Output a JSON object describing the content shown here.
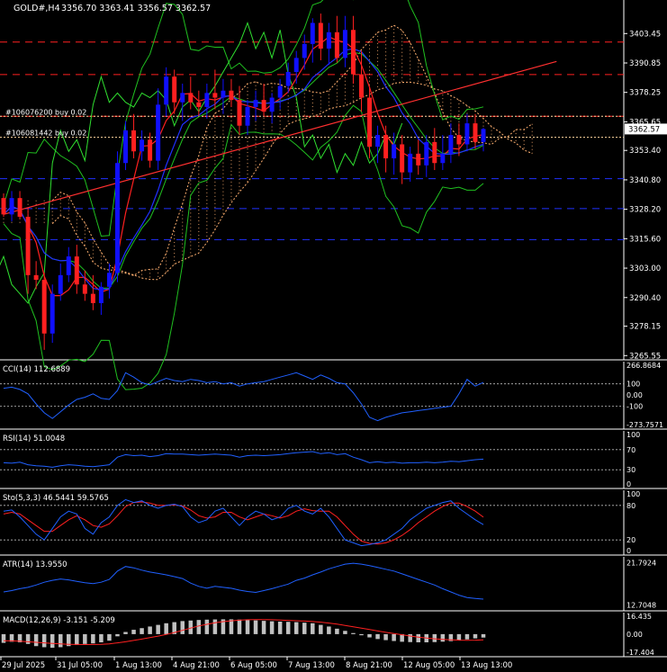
{
  "header": {
    "symbol_label": "GOLD#,H4",
    "ohlc_label": "3356.70 3363.41 3356.57 3362.57"
  },
  "colors": {
    "background": "#000000",
    "grid_text": "#ffffff",
    "bull_candle": "#1010ff",
    "bear_candle": "#ff2020",
    "bollinger": "#20c020",
    "bright_green": "#30e030",
    "ma_red": "#ff2020",
    "ma_blue": "#2030ff",
    "cloud_dots": "#ffb070",
    "order_line": "#ffd8a0",
    "red_dash": "#ff2020",
    "blue_dash": "#2030ff",
    "trendline": "#ff3030",
    "oscillator_line": "#2060ff",
    "stoch_signal": "#ff2020",
    "macd_hist": "#c0c0c0",
    "macd_signal": "#ff2020"
  },
  "chart_data": [
    {
      "type": "candlestick",
      "panel": "main",
      "price_axis_ticks": [
        "3403.45",
        "3390.85",
        "3378.25",
        "3365.65",
        "3353.40",
        "3340.80",
        "3328.20",
        "3315.60",
        "3303.00",
        "3290.40",
        "3278.15",
        "3265.55"
      ],
      "price_axis_values": [
        3403.45,
        3390.85,
        3378.25,
        3365.65,
        3353.4,
        3340.8,
        3328.2,
        3315.6,
        3303.0,
        3290.4,
        3278.15,
        3265.55
      ],
      "ylim": [
        3264.5,
        3415.5
      ],
      "current_price_label": "3362.57",
      "current_price": 3362.57,
      "orders": [
        {
          "label": "#106076200 buy 0.02",
          "price": 3368.0
        },
        {
          "label": "#106081442 buy 0.02",
          "price": 3359.0
        }
      ],
      "red_levels": [
        3399.8,
        3385.9,
        3368.0
      ],
      "blue_levels": [
        3341.3,
        3328.5,
        3315.2
      ],
      "trendline": {
        "from": [
          0,
          3326.0
        ],
        "to": [
          68,
          3391.5
        ]
      },
      "candles": [
        [
          3333,
          3335,
          3325,
          3326
        ],
        [
          3326,
          3336,
          3323,
          3333
        ],
        [
          3333,
          3336,
          3324,
          3325
        ],
        [
          3325,
          3329,
          3292,
          3300
        ],
        [
          3300,
          3306,
          3294,
          3298
        ],
        [
          3298,
          3301,
          3268,
          3275
        ],
        [
          3275,
          3296,
          3271,
          3292
        ],
        [
          3292,
          3305,
          3289,
          3300
        ],
        [
          3300,
          3312,
          3297,
          3308
        ],
        [
          3308,
          3313,
          3292,
          3296
        ],
        [
          3296,
          3302,
          3289,
          3292
        ],
        [
          3292,
          3300,
          3285,
          3288
        ],
        [
          3288,
          3297,
          3283,
          3295
        ],
        [
          3295,
          3305,
          3290,
          3301
        ],
        [
          3301,
          3353,
          3297,
          3348
        ],
        [
          3348,
          3366,
          3345,
          3362
        ],
        [
          3362,
          3369,
          3350,
          3353
        ],
        [
          3353,
          3362,
          3349,
          3358
        ],
        [
          3358,
          3361,
          3346,
          3349
        ],
        [
          3349,
          3380,
          3345,
          3373
        ],
        [
          3373,
          3389,
          3368,
          3385
        ],
        [
          3385,
          3388,
          3369,
          3374
        ],
        [
          3374,
          3382,
          3366,
          3378
        ],
        [
          3378,
          3385,
          3371,
          3374
        ],
        [
          3374,
          3379,
          3368,
          3372
        ],
        [
          3372,
          3382,
          3367,
          3378
        ],
        [
          3378,
          3388,
          3371,
          3376
        ],
        [
          3376,
          3384,
          3369,
          3379
        ],
        [
          3379,
          3384,
          3372,
          3375
        ],
        [
          3375,
          3381,
          3360,
          3364
        ],
        [
          3364,
          3375,
          3360,
          3372
        ],
        [
          3372,
          3379,
          3366,
          3375
        ],
        [
          3375,
          3382,
          3368,
          3370
        ],
        [
          3370,
          3378,
          3365,
          3376
        ],
        [
          3376,
          3384,
          3371,
          3381
        ],
        [
          3381,
          3391,
          3378,
          3387
        ],
        [
          3387,
          3396,
          3382,
          3393
        ],
        [
          3393,
          3403,
          3388,
          3399
        ],
        [
          3399,
          3410,
          3391,
          3408
        ],
        [
          3408,
          3412,
          3392,
          3397
        ],
        [
          3397,
          3408,
          3390,
          3404
        ],
        [
          3404,
          3411,
          3391,
          3393
        ],
        [
          3393,
          3411,
          3389,
          3405
        ],
        [
          3405,
          3411,
          3382,
          3386
        ],
        [
          3386,
          3396,
          3370,
          3376
        ],
        [
          3376,
          3381,
          3350,
          3355
        ],
        [
          3355,
          3364,
          3348,
          3360
        ],
        [
          3360,
          3364,
          3344,
          3350
        ],
        [
          3350,
          3361,
          3343,
          3356
        ],
        [
          3356,
          3360,
          3339,
          3344
        ],
        [
          3344,
          3355,
          3340,
          3352
        ],
        [
          3352,
          3358,
          3343,
          3347
        ],
        [
          3347,
          3360,
          3342,
          3357
        ],
        [
          3357,
          3363,
          3345,
          3348
        ],
        [
          3348,
          3360,
          3345,
          3352
        ],
        [
          3352,
          3365,
          3348,
          3360
        ],
        [
          3360,
          3365,
          3351,
          3356
        ],
        [
          3356,
          3369,
          3353,
          3365
        ],
        [
          3365,
          3369,
          3354,
          3357
        ],
        [
          3357,
          3363,
          3353,
          3362.57
        ]
      ]
    },
    {
      "type": "line",
      "panel": "cci",
      "label": "CCI(14) 112.6889",
      "axis_ticks": [
        "266.8684",
        "100",
        "0.00",
        "-100",
        "-273.7571"
      ],
      "axis_values": [
        266.8684,
        100,
        0,
        -100,
        -273.7571
      ],
      "dashed_levels": [
        100,
        -100
      ],
      "ylim": [
        -273.7571,
        266.8684
      ],
      "values": [
        60,
        70,
        50,
        10,
        -80,
        -160,
        -210,
        -150,
        -90,
        -40,
        -20,
        10,
        -30,
        -40,
        40,
        200,
        160,
        110,
        90,
        120,
        150,
        130,
        120,
        140,
        130,
        110,
        120,
        100,
        110,
        80,
        100,
        110,
        120,
        140,
        160,
        180,
        200,
        170,
        140,
        180,
        150,
        110,
        100,
        20,
        -80,
        -200,
        -230,
        -200,
        -180,
        -160,
        -150,
        -140,
        -130,
        -120,
        -110,
        -100,
        10,
        140,
        80,
        112.6889
      ]
    },
    {
      "type": "line",
      "panel": "rsi",
      "label": "RSI(14) 51.0048",
      "axis_ticks": [
        "100",
        "70",
        "30",
        "0"
      ],
      "axis_values": [
        100,
        70,
        30,
        0
      ],
      "dashed_levels": [
        70,
        30
      ],
      "ylim": [
        0,
        100
      ],
      "values": [
        44,
        43,
        45,
        40,
        38,
        37,
        35,
        38,
        40,
        39,
        37,
        36,
        38,
        40,
        55,
        60,
        58,
        59,
        56,
        58,
        62,
        61,
        61,
        60,
        59,
        60,
        61,
        60,
        59,
        55,
        58,
        59,
        58,
        59,
        60,
        62,
        64,
        65,
        66,
        62,
        64,
        60,
        62,
        55,
        50,
        44,
        46,
        44,
        45,
        43,
        44,
        44,
        45,
        44,
        45,
        47,
        46,
        48,
        50,
        51.0048
      ]
    },
    {
      "type": "line",
      "panel": "stochastic",
      "label": "Sto(5,3,3) 46.5441 59.5765",
      "axis_ticks": [
        "100",
        "80",
        "20",
        "0"
      ],
      "axis_values": [
        100,
        80,
        20,
        0
      ],
      "dashed_levels": [
        80,
        20
      ],
      "ylim": [
        0,
        100
      ],
      "main_values": [
        70,
        72,
        60,
        45,
        30,
        20,
        40,
        60,
        70,
        65,
        40,
        30,
        50,
        60,
        80,
        90,
        85,
        88,
        80,
        75,
        80,
        82,
        78,
        60,
        50,
        55,
        70,
        75,
        60,
        45,
        60,
        70,
        65,
        55,
        60,
        75,
        80,
        70,
        65,
        75,
        60,
        40,
        20,
        15,
        10,
        12,
        15,
        20,
        30,
        40,
        55,
        65,
        75,
        80,
        85,
        88,
        75,
        65,
        55,
        46.5441
      ],
      "signal_values": [
        65,
        68,
        65,
        55,
        45,
        35,
        35,
        45,
        55,
        62,
        55,
        45,
        42,
        48,
        62,
        78,
        85,
        86,
        84,
        80,
        80,
        81,
        79,
        72,
        62,
        58,
        60,
        68,
        68,
        60,
        55,
        60,
        65,
        62,
        58,
        62,
        70,
        74,
        71,
        70,
        70,
        60,
        45,
        30,
        18,
        14,
        13,
        15,
        20,
        28,
        38,
        50,
        60,
        70,
        78,
        84,
        84,
        78,
        70,
        59.5765
      ]
    },
    {
      "type": "line",
      "panel": "atr",
      "label": "ATR(14) 13.9550",
      "axis_ticks": [
        "21.7924",
        "12.7048"
      ],
      "axis_values": [
        21.7924,
        12.7048
      ],
      "ylim": [
        12.2,
        22.3
      ],
      "values": [
        15.5,
        15.8,
        16.2,
        16.5,
        17,
        17.6,
        18,
        18.3,
        18.1,
        17.8,
        17.5,
        17.3,
        17.6,
        18.2,
        20,
        21,
        20.7,
        20.2,
        19.8,
        19.5,
        19.2,
        18.8,
        18.4,
        17.4,
        16.7,
        16.3,
        16.7,
        16.5,
        16.3,
        15.9,
        15.6,
        15.4,
        15.8,
        16.2,
        16.7,
        17.2,
        18,
        18.5,
        19.2,
        19.8,
        20.5,
        21,
        21.5,
        21.7,
        21.5,
        21.2,
        20.8,
        20.4,
        20,
        19.4,
        18.8,
        18.2,
        17.6,
        17,
        16.2,
        15.5,
        14.8,
        14.3,
        14.1,
        13.955
      ]
    },
    {
      "type": "bar+line",
      "panel": "macd",
      "label": "MACD(12,26,9) -3.151 -5.209",
      "axis_ticks": [
        "16.435",
        "0.00",
        "-17.404"
      ],
      "axis_values": [
        16.435,
        0,
        -17.404
      ],
      "ylim": [
        -17.404,
        16.435
      ],
      "histogram": [
        -8,
        -7,
        -7.5,
        -9,
        -11,
        -12,
        -12.5,
        -12,
        -11,
        -10,
        -9,
        -8.5,
        -7.5,
        -6,
        -2,
        2,
        4,
        5.5,
        7,
        8.5,
        10,
        11,
        12,
        12.5,
        13,
        13.3,
        13.5,
        13.6,
        13.6,
        13.4,
        13,
        12.6,
        12.2,
        11.8,
        11.5,
        11.3,
        11,
        10.5,
        10,
        8.5,
        7,
        5,
        3,
        1,
        -1,
        -3,
        -4.5,
        -5.5,
        -6.3,
        -7,
        -7.3,
        -7.5,
        -7.5,
        -7.3,
        -6.9,
        -6.4,
        -5.5,
        -4.8,
        -3.9,
        -3.151
      ],
      "signal": [
        -6,
        -6.2,
        -6.5,
        -7,
        -7.5,
        -8,
        -8.5,
        -9,
        -9.3,
        -9.5,
        -9.6,
        -9.5,
        -9.3,
        -8.9,
        -8,
        -7,
        -5.8,
        -4.5,
        -3.2,
        -1.8,
        -0.3,
        1.5,
        3.5,
        5.5,
        7.5,
        9,
        10.5,
        11.5,
        12.2,
        12.8,
        13.2,
        13.3,
        13.3,
        13.2,
        12.9,
        12.6,
        12.3,
        12,
        11.6,
        11,
        10.2,
        9.2,
        8,
        6.8,
        5.5,
        4.2,
        2.9,
        1.7,
        0.5,
        -0.6,
        -1.7,
        -2.7,
        -3.6,
        -4.3,
        -4.8,
        -5.2,
        -5.5,
        -5.6,
        -5.5,
        -5.209
      ]
    }
  ],
  "time_axis": {
    "labels": [
      "29 Jul 2025",
      "31 Jul 05:00",
      "1 Aug 13:00",
      "4 Aug 21:00",
      "6 Aug 05:00",
      "7 Aug 13:00",
      "8 Aug 21:00",
      "12 Aug 05:00",
      "13 Aug 13:00"
    ]
  }
}
